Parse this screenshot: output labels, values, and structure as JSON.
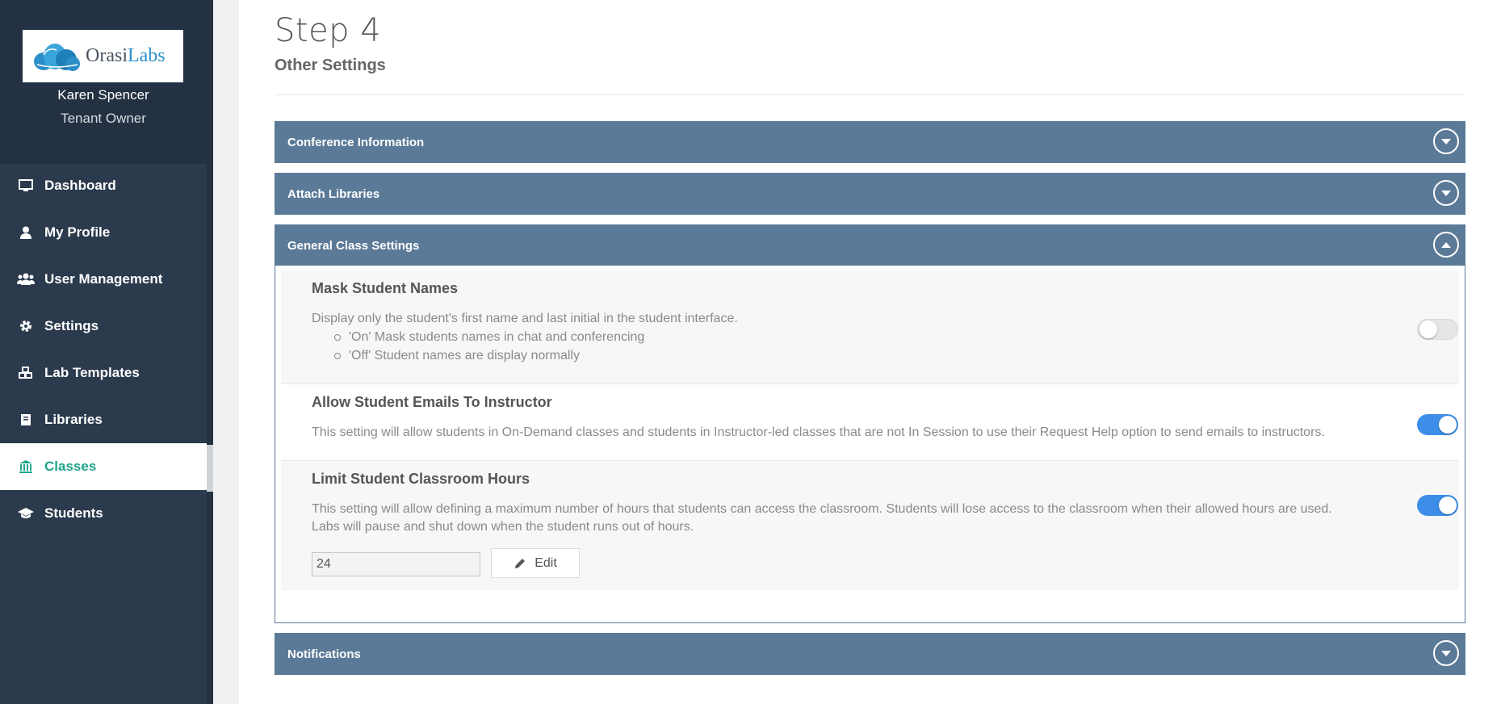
{
  "sidebar": {
    "logo": {
      "brand_main": "Orasi",
      "brand_accent": "Labs"
    },
    "user": {
      "name": "Karen Spencer",
      "role": "Tenant Owner"
    },
    "items": [
      {
        "label": "Dashboard",
        "icon": "monitor-icon"
      },
      {
        "label": "My Profile",
        "icon": "user-icon"
      },
      {
        "label": "User Management",
        "icon": "users-icon"
      },
      {
        "label": "Settings",
        "icon": "gear-icon"
      },
      {
        "label": "Lab Templates",
        "icon": "cubes-icon"
      },
      {
        "label": "Libraries",
        "icon": "book-icon"
      },
      {
        "label": "Classes",
        "icon": "institution-icon",
        "active": true
      },
      {
        "label": "Students",
        "icon": "graduation-cap-icon"
      }
    ]
  },
  "main": {
    "step_title": "Step 4",
    "step_subtitle": "Other Settings",
    "panels": {
      "conference": "Conference Information",
      "libraries": "Attach Libraries",
      "general": "General Class Settings",
      "notifications": "Notifications"
    },
    "settings": {
      "mask": {
        "title": "Mask Student Names",
        "desc": "Display only the student's first name and last initial in the student interface.",
        "bullets": [
          "'On' Mask students names in chat and conferencing",
          "'Off' Student names are display normally"
        ],
        "enabled": false
      },
      "emails": {
        "title": "Allow Student Emails To Instructor",
        "desc": "This setting will allow students in On-Demand classes and students in Instructor-led classes that are not In Session to use their Request Help option to send emails to instructors.",
        "enabled": true
      },
      "hours": {
        "title": "Limit Student Classroom Hours",
        "desc_line1": "This setting will allow defining a maximum number of hours that students can access the classroom. Students will lose access to the classroom when their allowed hours are used.",
        "desc_line2": "Labs will pause and shut down when the student runs out of hours.",
        "value": "24",
        "edit_label": "Edit",
        "enabled": true
      }
    }
  },
  "colors": {
    "sidebar_bg": "#2b3a4d",
    "active_accent": "#1fa58c",
    "panel_header": "#5b7a98",
    "toggle_on": "#3d8ee8"
  }
}
